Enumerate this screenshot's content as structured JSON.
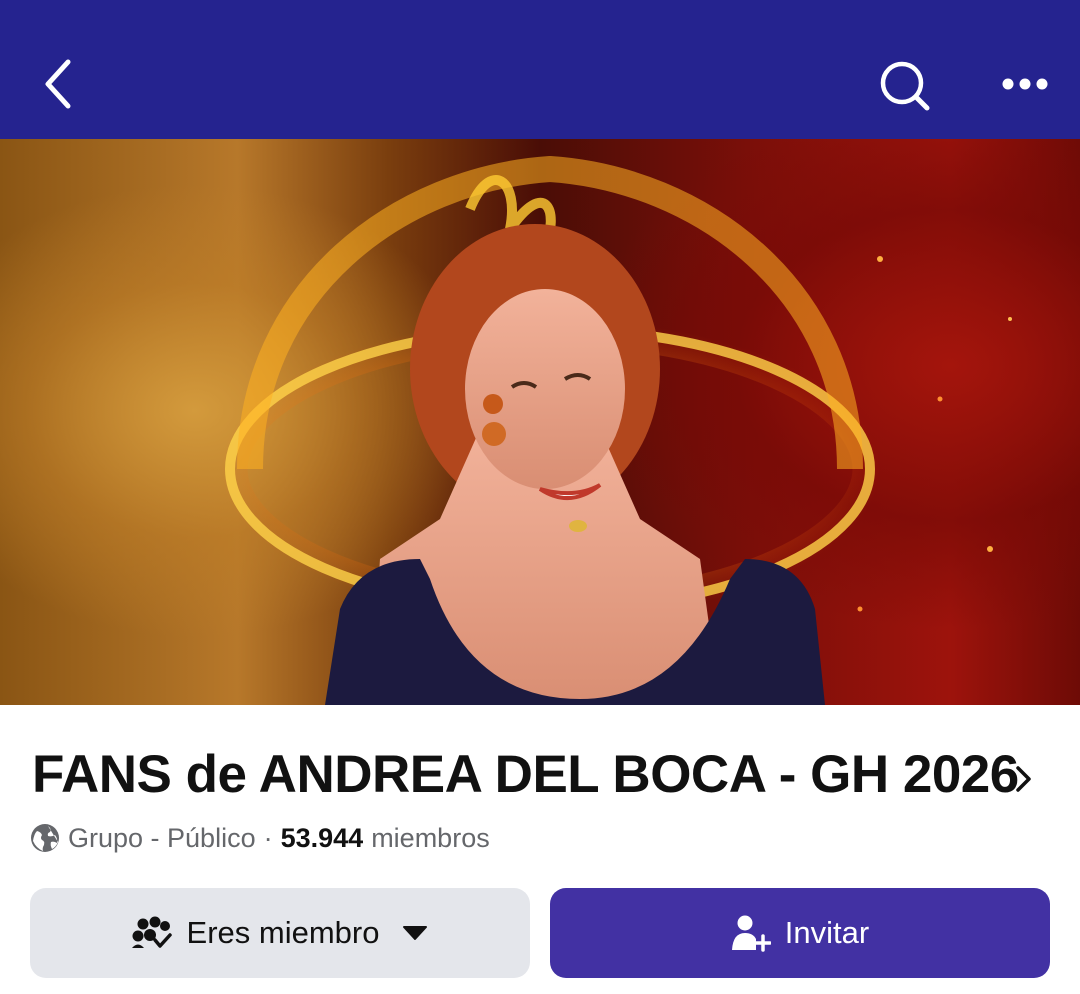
{
  "header": {
    "back_icon": "chevron-left-icon",
    "search_icon": "search-icon",
    "more_icon": "more-horizontal-icon",
    "background_color": "#25238f"
  },
  "cover": {
    "description_colors": {
      "left": "#b7782a",
      "right": "#9d130c"
    }
  },
  "group": {
    "title": "FANS de ANDREA DEL BOCA - GH 2026",
    "type": "Grupo - Público",
    "separator": "·",
    "member_count": "53.944",
    "members_label": "miembros"
  },
  "actions": {
    "member_label": "Eres miembro",
    "invite_label": "Invitar",
    "invite_color": "#4231a3",
    "member_color": "#e4e6eb"
  }
}
